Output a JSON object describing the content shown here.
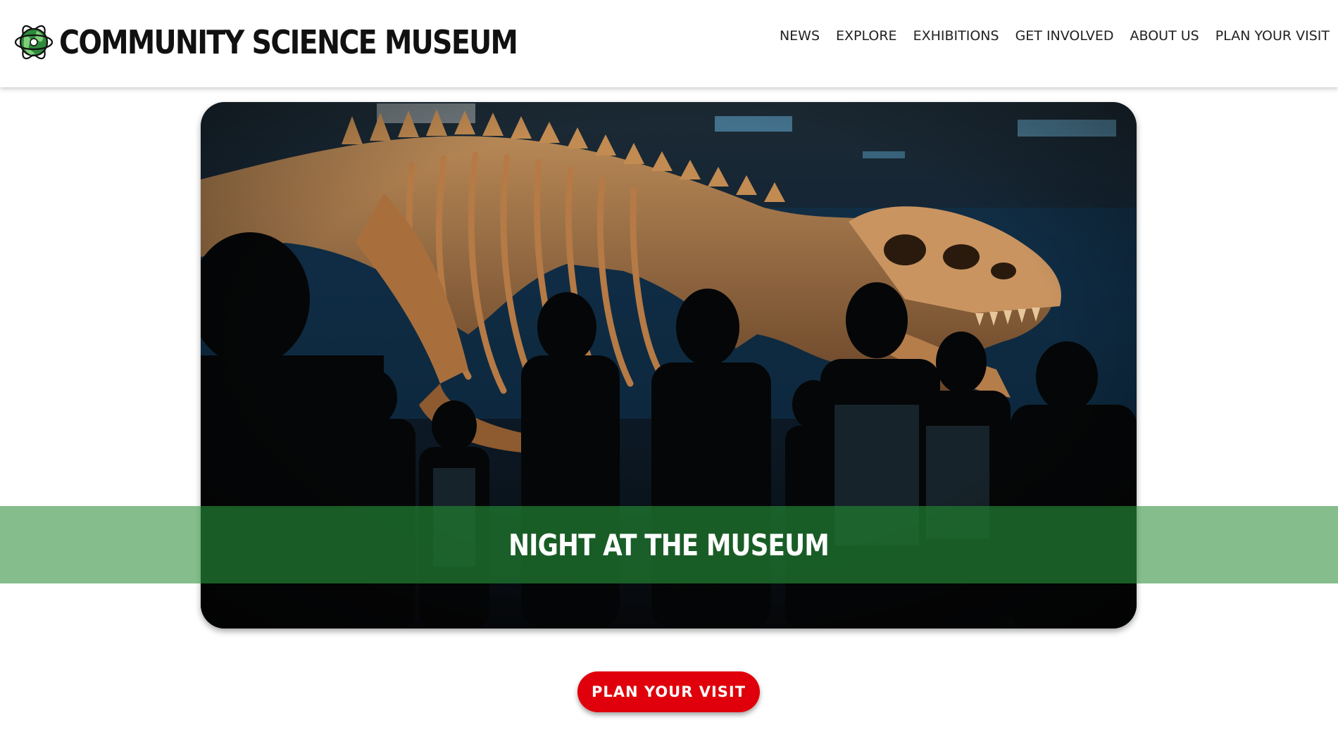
{
  "header": {
    "logo_icon": "atom-globe-icon",
    "title": "COMMUNITY SCIENCE MUSEUM"
  },
  "nav": {
    "items": [
      {
        "label": "NEWS"
      },
      {
        "label": "EXPLORE"
      },
      {
        "label": "EXHIBITIONS"
      },
      {
        "label": "GET INVOLVED"
      },
      {
        "label": "ABOUT US"
      },
      {
        "label": "PLAN YOUR VISIT"
      }
    ]
  },
  "hero": {
    "image": "t-rex-skeleton-exhibit-photo",
    "title": "NIGHT AT THE MUSEUM"
  },
  "cta": {
    "label": "PLAN YOUR VISIT"
  },
  "colors": {
    "brand_green": "#2f8a3c",
    "banner_green": "#4fa35a",
    "cta_red": "#e0000b",
    "text_dark": "#111111"
  }
}
